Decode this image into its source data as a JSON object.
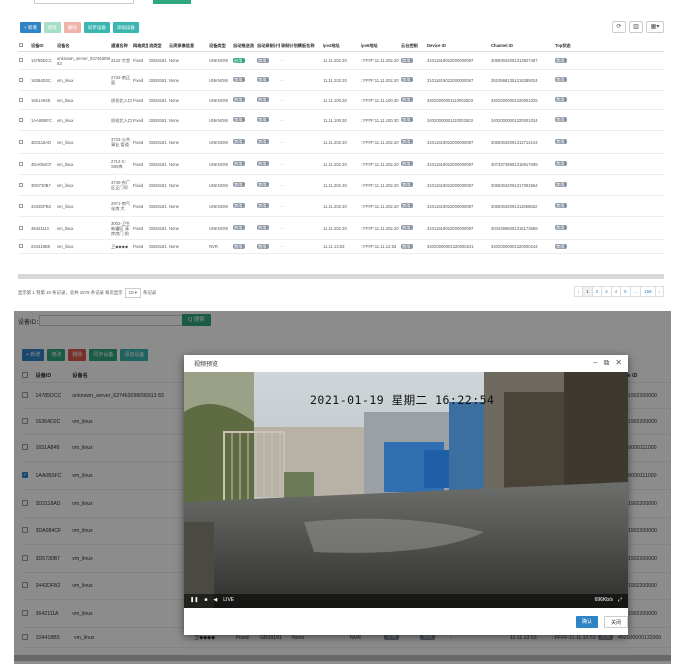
{
  "top": {
    "toolbar": [
      "+ 新增",
      "修改",
      "删除",
      "同步设备",
      "添加设备"
    ],
    "tools": [
      "⟳",
      "▥",
      "▦▾"
    ],
    "headers": [
      "设备ID",
      "设备名",
      "通道名称",
      "网络类型",
      "流类型",
      "云爬录像信息",
      "设备类型",
      "自动推送流",
      "自动录制计划",
      "录制计划模板名称",
      "ipv4地址",
      "ipv6地址",
      "云台控制",
      "Device ID",
      "Channel ID",
      "Top状态"
    ],
    "rows": [
      [
        "14785DCC",
        "unknown_server_637463098095913 83",
        "3142-大堂",
        "Fixed",
        "GB28181",
        "None",
        "UNKNOW",
        "启用",
        "禁用",
        "-",
        "11.11.202.20",
        "::FFFF:11.11.202.20",
        "禁用",
        "31011619022000000087",
        "30693042091313927467",
        "禁用"
      ],
      [
        "16364D2C",
        "vm_linux",
        "2732-南正面",
        "Fixed",
        "GB28181",
        "None",
        "UNKNOW",
        "禁用",
        "禁用",
        "-",
        "11.11.202.20",
        "::FFFF:11.11.202.20",
        "禁用",
        "31011619022000000087",
        "36105981351318389024",
        "禁用"
      ],
      [
        "1651A848",
        "vm_linux",
        "质检北入口",
        "Fixed",
        "GB28181",
        "None",
        "UNKNOW",
        "禁用",
        "禁用",
        "-",
        "11.11.100.30",
        "::FFFF:11.11.100.30",
        "禁用",
        "34020000001110002503",
        "34020000001320001025",
        "禁用"
      ],
      [
        "1AA0B5FC",
        "vm_linux",
        "质检北入口",
        "Fixed",
        "GB28181",
        "None",
        "UNKNOW",
        "禁用",
        "禁用",
        "-",
        "11.11.100.30",
        "::FFFF:11.11.100.30",
        "禁用",
        "34020000001110002503",
        "34020000001320001024",
        "禁用"
      ],
      [
        "3D3118AD",
        "vm_linux",
        "3733-公共事业 管道",
        "Fixed",
        "GB28181",
        "None",
        "UNKNOW",
        "禁用",
        "禁用",
        "-",
        "11.11.202.20",
        "::FFFF:11.11.202.20",
        "禁用",
        "31011619022000000087",
        "30693042091312714144",
        "禁用"
      ],
      [
        "3DA084CF",
        "vm_linux",
        "2712-C-S09库",
        "Fixed",
        "GB28181",
        "None",
        "UNKNOW",
        "禁用",
        "禁用",
        "-",
        "11.11.202.20",
        "::FFFF:11.11.202.20",
        "禁用",
        "31011619022000000087",
        "30733735991316917008",
        "禁用"
      ],
      [
        "3D5730B7",
        "vm_linux",
        "3740-东厂区正门坝",
        "Fixed",
        "GB28181",
        "None",
        "UNKNOW",
        "禁用",
        "禁用",
        "-",
        "11.11.202.20",
        "::FFFF:11.11.202.20",
        "禁用",
        "31011619022000000087",
        "30693042091317082564",
        "禁用"
      ],
      [
        "3442DFB2",
        "vm_linux",
        "2971-南气化南 大",
        "Fixed",
        "GB28181",
        "None",
        "UNKNOW",
        "禁用",
        "禁用",
        "-",
        "11.11.202.20",
        "::FFFF:11.11.202.20",
        "禁用",
        "31011619022000000087",
        "30693042091311955662",
        "禁用"
      ],
      [
        "3642111A",
        "vm_linux",
        "3002-卫生新罐区 清库房门 前",
        "Fixed",
        "GB28181",
        "None",
        "UNKNOW",
        "禁用",
        "禁用",
        "-",
        "11.11.202.20",
        "::FFFF:11.11.202.20",
        "禁用",
        "31011619022000000087",
        "30443986091315173658",
        "禁用"
      ],
      [
        "224418B5",
        "vm_linux",
        "卫◆◆◆◆",
        "Fixed",
        "GB28181",
        "None",
        "NVR",
        "禁用",
        "禁用",
        "-",
        "11.11.13.53",
        "::FFFF:11.11.13.53",
        "禁用",
        "34020000001320000241",
        "34020000001320000244",
        "禁用"
      ]
    ],
    "footer": {
      "summary": "显示第 1 到第 10 条记录，总共 1579 条记录 每页显示",
      "per_page": "10 ▾",
      "suffix": "条记录"
    },
    "pager": [
      "‹",
      "1",
      "2",
      "3",
      "4",
      "5",
      "...",
      "158",
      "›"
    ]
  },
  "bottom": {
    "search_label": "设备ID：",
    "search_button": "Q 搜索",
    "toolbar": [
      "+ 新增",
      "修改",
      "删除",
      "同步设备",
      "添加设备"
    ],
    "headers": [
      "设备ID",
      "设备名",
      "Device ID"
    ],
    "rows": [
      {
        "id": "14785DCC",
        "name": "unknown_server_637463098095913 83",
        "dev": "101161902200000"
      },
      {
        "id": "16364D2C",
        "name": "vm_linux",
        "dev": "101161902200000"
      },
      {
        "id": "1651A848",
        "name": "vm_linux",
        "dev": "402000000111000"
      },
      {
        "id": "1AA0B5FC",
        "name": "vm_linux",
        "dev": "402000000111000"
      },
      {
        "id": "3D3118AD",
        "name": "vm_linux",
        "dev": "101161902200000"
      },
      {
        "id": "3DA084CF",
        "name": "vm_linux",
        "dev": "101161902200000"
      },
      {
        "id": "3D5730B7",
        "name": "vm_linux",
        "dev": "101161902200000"
      },
      {
        "id": "3442DFB2",
        "name": "vm_linux",
        "dev": "101161902200000"
      },
      {
        "id": "3642111A",
        "name": "vm_linux",
        "dev": "101161902200000"
      },
      {
        "id": "224418B5",
        "name": "vm_linux",
        "dev": "402000000132000"
      }
    ],
    "last_row_extra": {
      "channel": "卫◆◆◆◆",
      "type": "Fixed",
      "proto": "GB28181",
      "rec": "None",
      "dtype": "NVR",
      "push": "禁用",
      "plan": "禁用",
      "tpl": "-",
      "ipv4": "11.11.13.53",
      "ipv6": "::FFFF:11.11.13.53",
      "ptz": "禁用"
    },
    "checked_row": 3,
    "modal": {
      "title": "视频预览",
      "osd": "2021-01-19  星期二  16:22:54",
      "live": "LIVE",
      "rate": "696Kb/s",
      "ok": "确认",
      "close": "关闭"
    }
  }
}
